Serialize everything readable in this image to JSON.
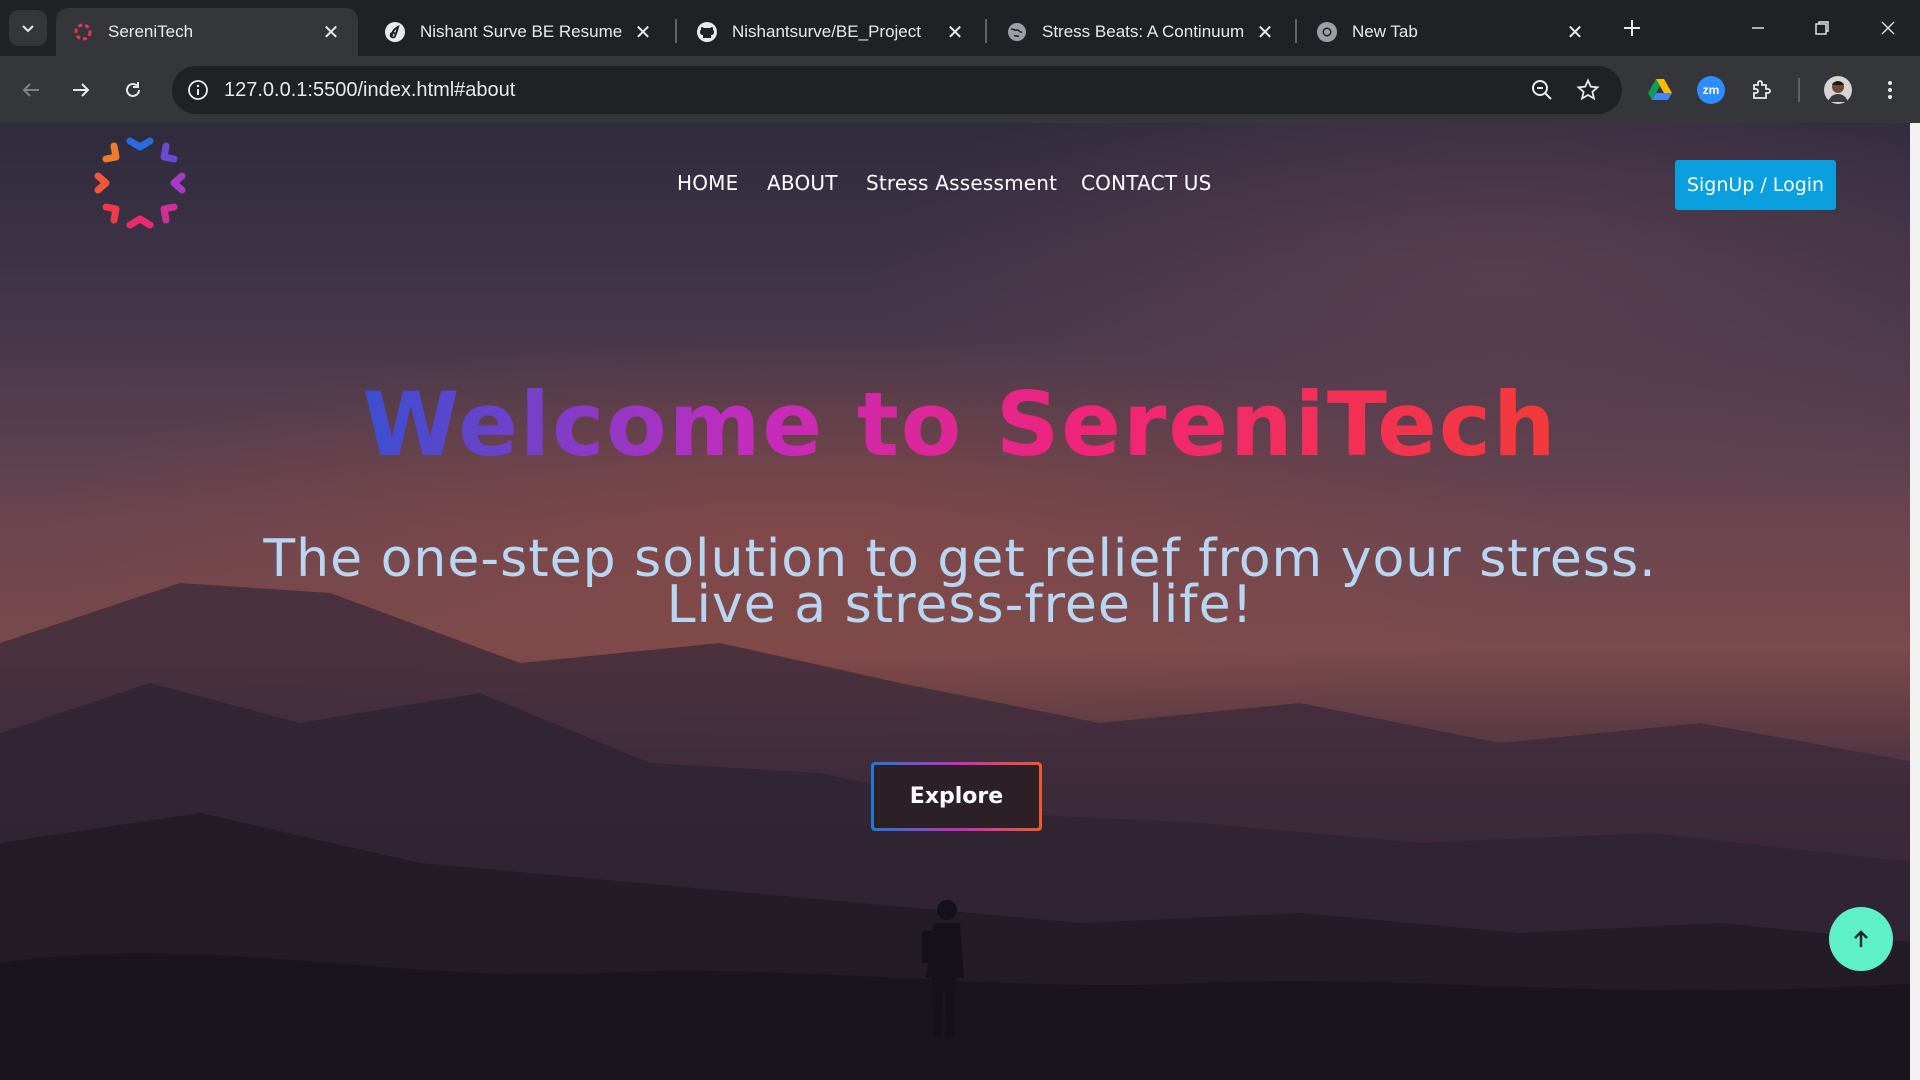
{
  "browser": {
    "tabs": [
      {
        "title": "SereniTech",
        "active": true,
        "icon": "serenitech-favicon"
      },
      {
        "title": "Nishant Surve BE Resume - Or",
        "active": false,
        "icon": "overleaf-favicon"
      },
      {
        "title": "Nishantsurve/BE_Project",
        "active": false,
        "icon": "github-favicon"
      },
      {
        "title": "Stress Beats: A Continuum of I",
        "active": false,
        "icon": "globe-favicon"
      },
      {
        "title": "New Tab",
        "active": false,
        "icon": "chrome-favicon"
      }
    ],
    "url": "127.0.0.1:5500/index.html#about",
    "extensions": [
      "google-drive-icon",
      "zoom-icon",
      "puzzle-icon"
    ],
    "zoom_ext_label": "zm"
  },
  "site": {
    "nav": {
      "home": "HOME",
      "about": "ABOUT",
      "stress": "Stress Assessment",
      "contact": "CONTACT US"
    },
    "signup": "SignUp / Login",
    "hero": {
      "title": "Welcome to SereniTech",
      "subtitle": "The one-step solution to get relief from your stress. Live a stress-free life!",
      "cta": "Explore"
    },
    "colors": {
      "signup_bg": "#0aa0e0",
      "back_to_top_bg": "#5ef0c6",
      "subtitle_color": "#b8d6f2",
      "title_gradient": [
        "#3a4fd0",
        "#c32cbf",
        "#f0247a",
        "#f43a3a"
      ]
    }
  }
}
